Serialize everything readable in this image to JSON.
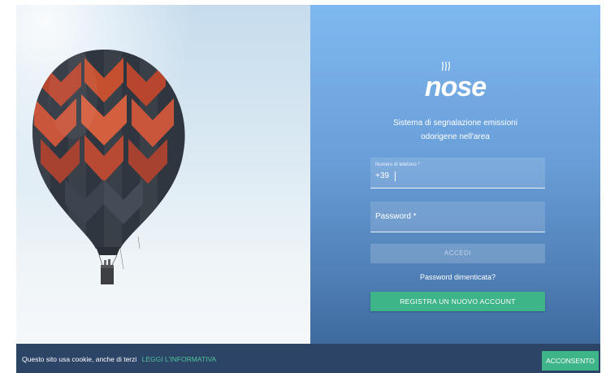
{
  "brand": {
    "logo_text": "nose",
    "tagline_line1": "Sistema di segnalazione emissioni",
    "tagline_line2": "odorigene nell'area"
  },
  "login_form": {
    "phone_label": "Numero di telefono *",
    "phone_prefix": "+39",
    "password_label": "Password *",
    "login_button": "ACCEDI",
    "forgot_password": "Password dimenticata?",
    "register_button": "REGISTRA UN NUOVO ACCOUNT"
  },
  "cookie_banner": {
    "text": "Questo sito usa cookie, anche di terzi",
    "link": "LEGGI L'INFORMATIVA",
    "consent_button": "ACCONSENTO"
  },
  "colors": {
    "accent_green": "#3eb489",
    "panel_blue": "#6a9fd9",
    "cookie_bar": "#2c4466"
  },
  "icons": {
    "hero_image": "hot-air-balloon-illustration",
    "logo_mark": "odor-waves-icon"
  }
}
